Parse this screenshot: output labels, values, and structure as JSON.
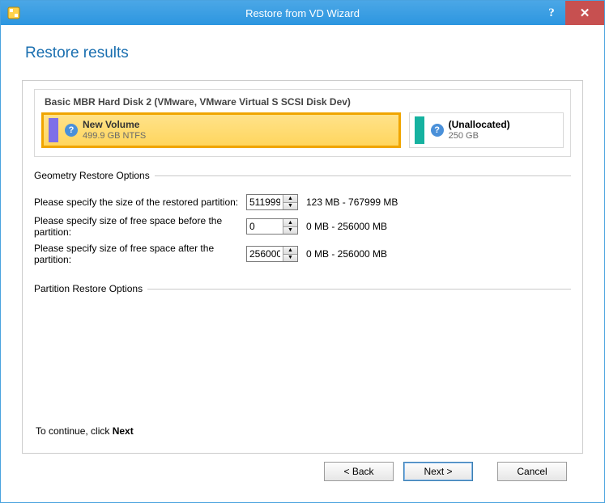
{
  "window": {
    "title": "Restore from VD Wizard",
    "help_glyph": "?",
    "close_glyph": "✕"
  },
  "page": {
    "heading": "Restore results"
  },
  "disk": {
    "title": "Basic MBR Hard Disk 2 (VMware, VMware Virtual S SCSI Disk Dev)",
    "partitions": [
      {
        "name": "New Volume",
        "sub": "499.9 GB NTFS",
        "stripe": "purple",
        "selected": true,
        "flex": 2.4
      },
      {
        "name": "(Unallocated)",
        "sub": "250 GB",
        "stripe": "teal",
        "selected": false,
        "flex": 1
      }
    ]
  },
  "geometry": {
    "legend": "Geometry Restore Options",
    "rows": [
      {
        "label": "Please specify the size of the restored partition:",
        "value": "511999",
        "range": "123 MB - 767999 MB"
      },
      {
        "label": "Please specify size of free space before the partition:",
        "value": "0",
        "range": "0 MB - 256000 MB"
      },
      {
        "label": "Please specify size of free space after the partition:",
        "value": "256000",
        "range": "0 MB - 256000 MB"
      }
    ]
  },
  "partition_opts": {
    "legend": "Partition Restore Options"
  },
  "footer": {
    "continue_prefix": "To continue, click ",
    "continue_bold": "Next"
  },
  "buttons": {
    "back": "< Back",
    "next": "Next >",
    "cancel": "Cancel"
  }
}
